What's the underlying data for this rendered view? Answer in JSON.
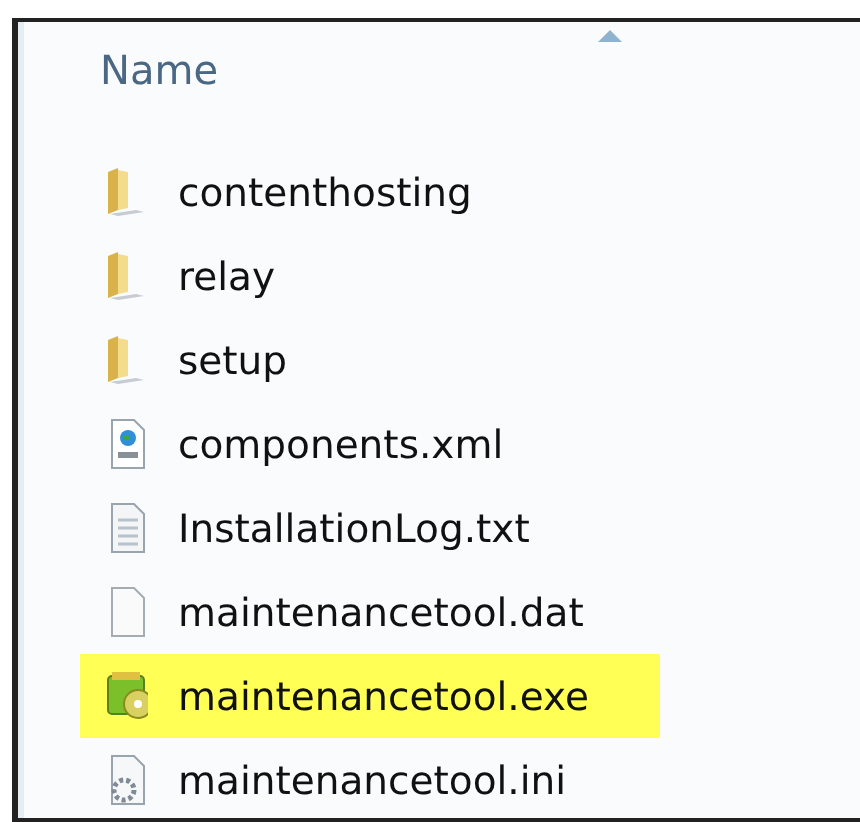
{
  "column_header": {
    "label": "Name"
  },
  "files": [
    {
      "name": "contenthosting",
      "kind": "folder",
      "highlighted": false
    },
    {
      "name": "relay",
      "kind": "folder",
      "highlighted": false
    },
    {
      "name": "setup",
      "kind": "folder",
      "highlighted": false
    },
    {
      "name": "components.xml",
      "kind": "xml",
      "highlighted": false
    },
    {
      "name": "InstallationLog.txt",
      "kind": "txt",
      "highlighted": false
    },
    {
      "name": "maintenancetool.dat",
      "kind": "dat",
      "highlighted": false
    },
    {
      "name": "maintenancetool.exe",
      "kind": "exe",
      "highlighted": true
    },
    {
      "name": "maintenancetool.ini",
      "kind": "ini",
      "highlighted": false
    }
  ]
}
